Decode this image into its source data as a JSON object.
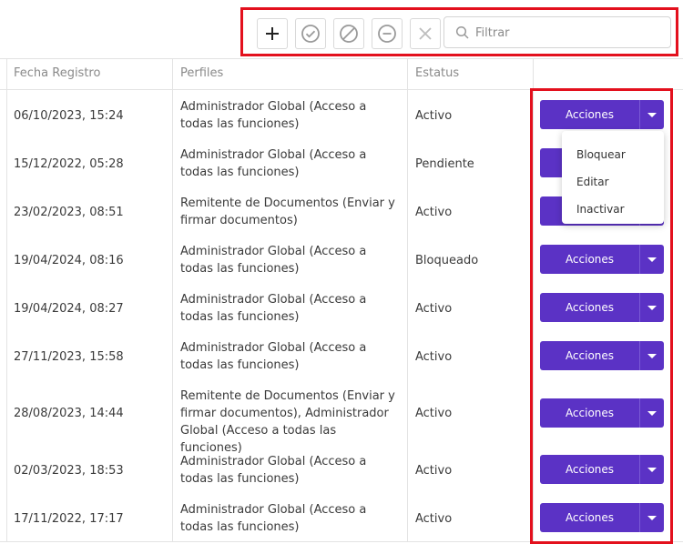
{
  "toolbar": {
    "buttons": [
      {
        "name": "add-button",
        "icon": "plus-icon"
      },
      {
        "name": "approve-button",
        "icon": "check-circle-icon"
      },
      {
        "name": "block-button",
        "icon": "ban-icon"
      },
      {
        "name": "deactivate-button",
        "icon": "minus-circle-icon"
      },
      {
        "name": "delete-button",
        "icon": "close-icon"
      }
    ],
    "search_placeholder": "Filtrar"
  },
  "table": {
    "headers": {
      "fecha": "Fecha Registro",
      "perfiles": "Perfiles",
      "estatus": "Estatus"
    },
    "rows": [
      {
        "fecha": "06/10/2023, 15:24",
        "perfiles": "Administrador Global (Acceso a todas las funciones)",
        "estatus": "Activo"
      },
      {
        "fecha": "15/12/2022, 05:28",
        "perfiles": "Administrador Global (Acceso a todas las funciones)",
        "estatus": "Pendiente"
      },
      {
        "fecha": "23/02/2023, 08:51",
        "perfiles": "Remitente de Documentos (Enviar y firmar documentos)",
        "estatus": "Activo"
      },
      {
        "fecha": "19/04/2024, 08:16",
        "perfiles": "Administrador Global (Acceso a todas las funciones)",
        "estatus": "Bloqueado"
      },
      {
        "fecha": "19/04/2024, 08:27",
        "perfiles": "Administrador Global (Acceso a todas las funciones)",
        "estatus": "Activo"
      },
      {
        "fecha": "27/11/2023, 15:58",
        "perfiles": "Administrador Global (Acceso a todas las funciones)",
        "estatus": "Activo"
      },
      {
        "fecha": "28/08/2023, 14:44",
        "perfiles": "Remitente de Documentos (Enviar y firmar documentos), Administrador Global (Acceso a todas las funciones)",
        "estatus": "Activo"
      },
      {
        "fecha": "02/03/2023, 18:53",
        "perfiles": "Administrador Global (Acceso a todas las funciones)",
        "estatus": "Activo"
      },
      {
        "fecha": "17/11/2022, 17:17",
        "perfiles": "Administrador Global (Acceso a todas las funciones)",
        "estatus": "Activo"
      }
    ]
  },
  "actions": {
    "button_label": "Acciones",
    "dropdown_items": [
      "Bloquear",
      "Editar",
      "Inactivar"
    ]
  },
  "colors": {
    "accent": "#5b32c5",
    "highlight_border": "#e3101d"
  }
}
